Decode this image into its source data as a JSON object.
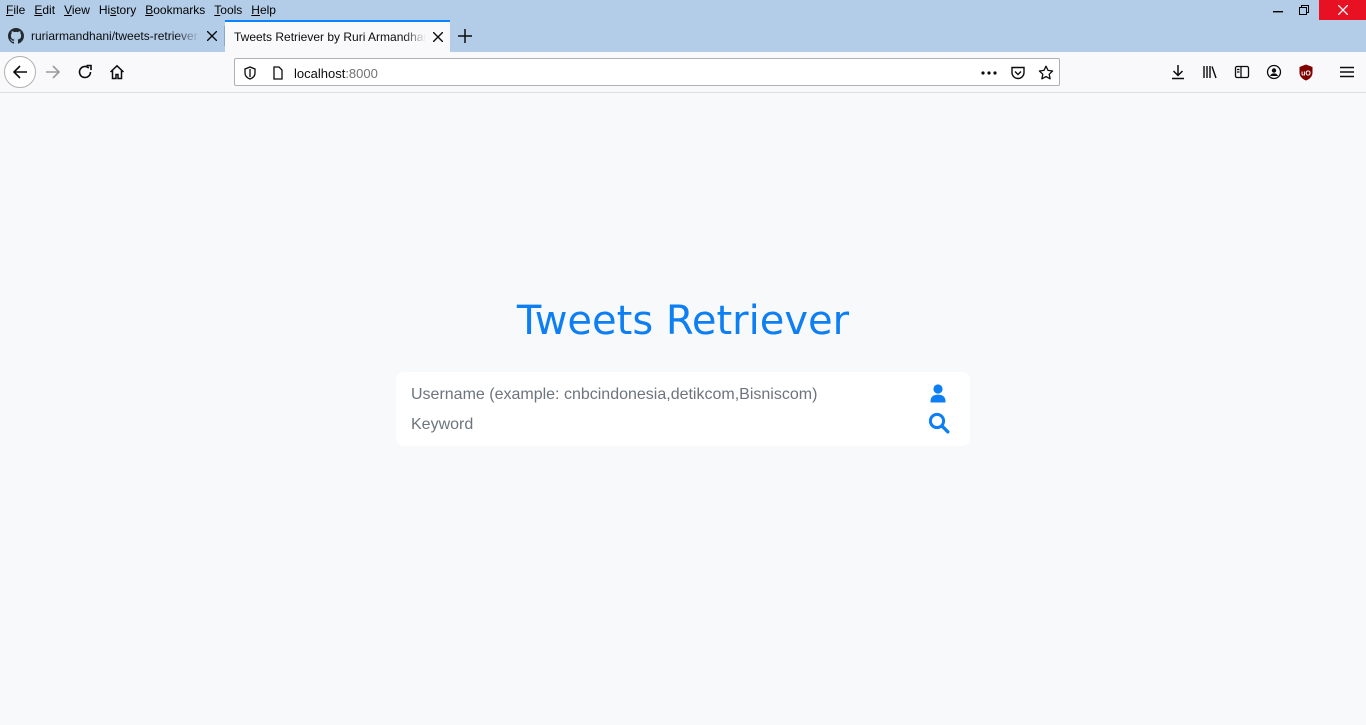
{
  "menu": [
    "File",
    "Edit",
    "View",
    "History",
    "Bookmarks",
    "Tools",
    "Help"
  ],
  "menu_accel": [
    "F",
    "E",
    "V",
    "s",
    "B",
    "T",
    "H"
  ],
  "tabs": [
    {
      "title": "ruriarmandhani/tweets-retriever",
      "icon": "github-icon",
      "active": false
    },
    {
      "title": "Tweets Retriever by Ruri Armandhani",
      "active": true
    }
  ],
  "address": {
    "host": "localhost",
    "port": ":8000"
  },
  "page": {
    "heading": "Tweets Retriever",
    "username_placeholder": "Username (example: cnbcindonesia,detikcom,Bisniscom)",
    "keyword_placeholder": "Keyword",
    "username_icon": "user-icon",
    "keyword_icon": "search-icon"
  },
  "colors": {
    "accent": "#0d7ff3",
    "chrome": "#b3cde8",
    "page_bg": "#f8f9fa",
    "close_red": "#e81123"
  }
}
